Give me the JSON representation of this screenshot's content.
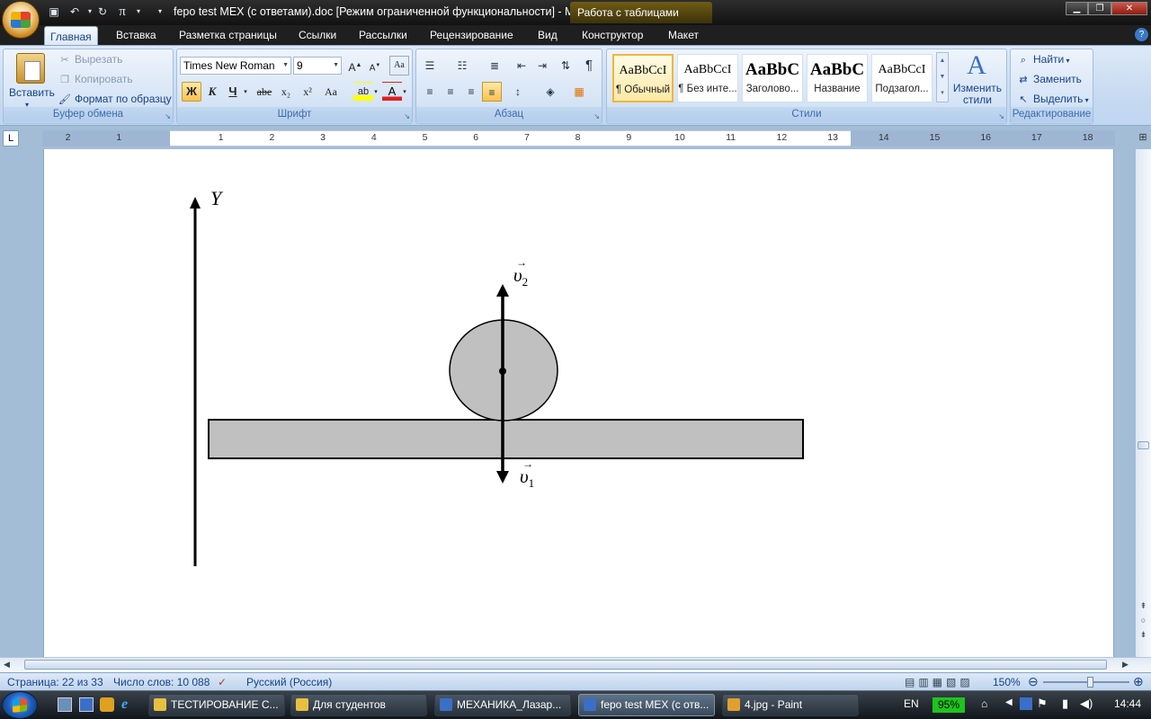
{
  "titlebar": {
    "title": "fepo test MEX (с ответами).doc [Режим ограниченной функциональности] - M",
    "context_tab": "Работа с таблицами"
  },
  "quick_access": {
    "save_icon": "save-icon",
    "undo_icon": "undo-icon",
    "redo_icon": "redo-icon",
    "pi_symbol": "π"
  },
  "ribbon_tabs": [
    "Главная",
    "Вставка",
    "Разметка страницы",
    "Ссылки",
    "Рассылки",
    "Рецензирование",
    "Вид",
    "Конструктор",
    "Макет"
  ],
  "clipboard": {
    "paste": "Вставить",
    "cut": "Вырезать",
    "copy": "Копировать",
    "format_painter": "Формат по образцу",
    "group": "Буфер обмена"
  },
  "font": {
    "name": "Times New Roman",
    "size": "9",
    "group": "Шрифт",
    "bold": "Ж",
    "italic": "К",
    "underline": "Ч",
    "strike": "abe",
    "subscript": "x₂",
    "superscript": "x²",
    "case": "Aa"
  },
  "paragraph": {
    "group": "Абзац"
  },
  "styles": {
    "group": "Стили",
    "items": [
      {
        "sample": "AaBbCcI",
        "name": "¶ Обычный"
      },
      {
        "sample": "AaBbCcI",
        "name": "¶ Без инте..."
      },
      {
        "sample": "AaBbC",
        "name": "Заголово..."
      },
      {
        "sample": "AaBbC",
        "name": "Название"
      },
      {
        "sample": "AaBbCcI",
        "name": "Подзагол..."
      }
    ],
    "change": "Изменить стили"
  },
  "editing": {
    "group": "Редактирование",
    "find": "Найти",
    "replace": "Заменить",
    "select": "Выделить"
  },
  "ruler": {
    "tab_marker": "L",
    "left_numbers": [
      "2",
      "1"
    ],
    "numbers": [
      "1",
      "2",
      "3",
      "4",
      "5",
      "6",
      "7",
      "8",
      "9",
      "10",
      "11",
      "12",
      "13",
      "14",
      "15",
      "16",
      "17",
      "18"
    ]
  },
  "figure": {
    "axis_label": "Y",
    "v2_label": "υ",
    "v2_sub": "2",
    "v1_label": "υ",
    "v1_sub": "1"
  },
  "status": {
    "page": "Страница: 22 из 33",
    "words": "Число слов: 10 088",
    "language": "Русский (Россия)",
    "zoom": "150%"
  },
  "taskbar": {
    "items": [
      {
        "label": "ТЕСТИРОВАНИЕ С...",
        "color": "#e8c040"
      },
      {
        "label": "Для студентов",
        "color": "#e8c040"
      },
      {
        "label": "МЕХАНИКА_Лазар...",
        "color": "#3a6fc8"
      },
      {
        "label": "fepo test MEX (с отв...",
        "color": "#3a6fc8"
      },
      {
        "label": "4.jpg - Paint",
        "color": "#e0a030"
      }
    ],
    "lang": "EN",
    "battery": "95%",
    "time": "14:44"
  }
}
